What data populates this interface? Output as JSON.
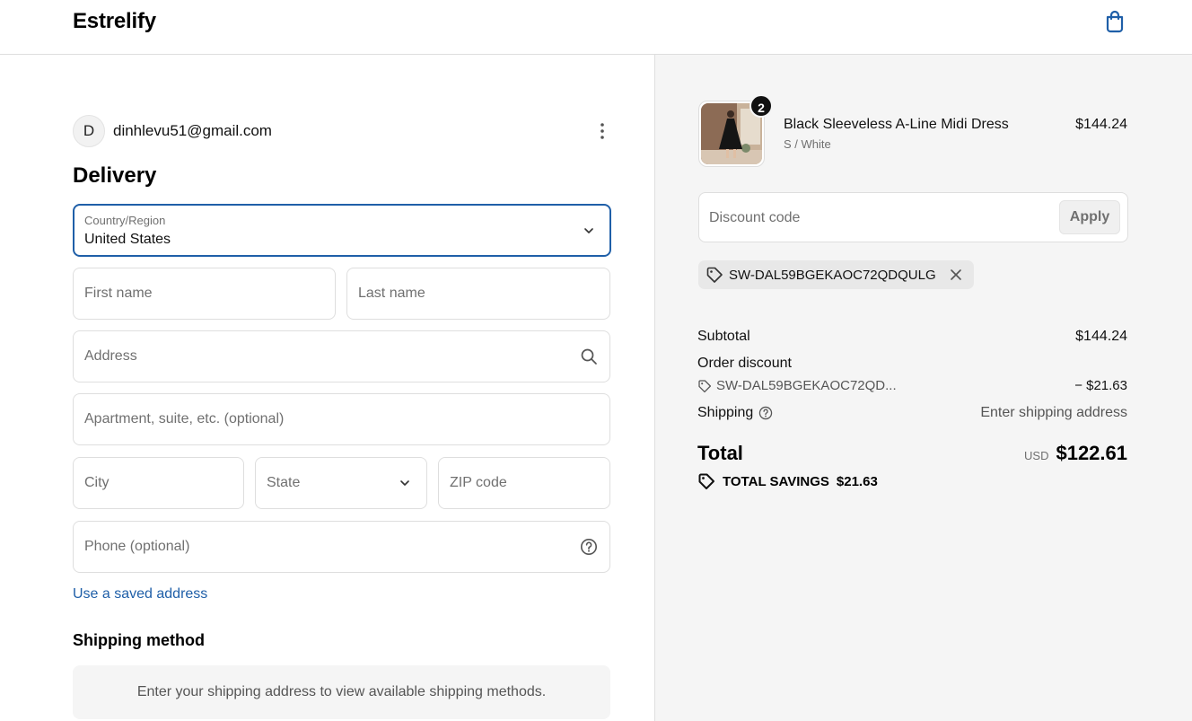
{
  "header": {
    "brand": "Estrelify",
    "cart_icon": "shopping-bag-icon"
  },
  "account": {
    "avatar_initial": "D",
    "email": "dinhlevu51@gmail.com",
    "menu_icon": "more-vertical-icon"
  },
  "delivery": {
    "heading": "Delivery",
    "country": {
      "label": "Country/Region",
      "value": "United States"
    },
    "first_name_placeholder": "First name",
    "last_name_placeholder": "Last name",
    "address_placeholder": "Address",
    "apartment_placeholder": "Apartment, suite, etc. (optional)",
    "city_placeholder": "City",
    "state_placeholder": "State",
    "zip_placeholder": "ZIP code",
    "phone_placeholder": "Phone (optional)",
    "saved_address_link": "Use a saved address"
  },
  "shipping_method": {
    "heading": "Shipping method",
    "notice": "Enter your shipping address to view available shipping methods."
  },
  "order": {
    "item": {
      "name": "Black Sleeveless A-Line Midi Dress",
      "variant": "S / White",
      "price": "$144.24",
      "quantity": "2"
    },
    "discount": {
      "placeholder": "Discount code",
      "apply_label": "Apply",
      "applied_code": "SW-DAL59BGEKAOC72QDQULG"
    },
    "summary": {
      "subtotal_label": "Subtotal",
      "subtotal_value": "$144.24",
      "order_discount_label": "Order discount",
      "discount_code_short": "SW-DAL59BGEKAOC72QD...",
      "discount_value": "− $21.63",
      "shipping_label": "Shipping",
      "shipping_value": "Enter shipping address",
      "total_label": "Total",
      "currency": "USD",
      "total_value": "$122.61",
      "savings_label": "TOTAL SAVINGS",
      "savings_value": "$21.63"
    }
  },
  "colors": {
    "accent": "#1f5fa8",
    "panel_bg": "#f5f5f5",
    "border": "#dedede"
  }
}
